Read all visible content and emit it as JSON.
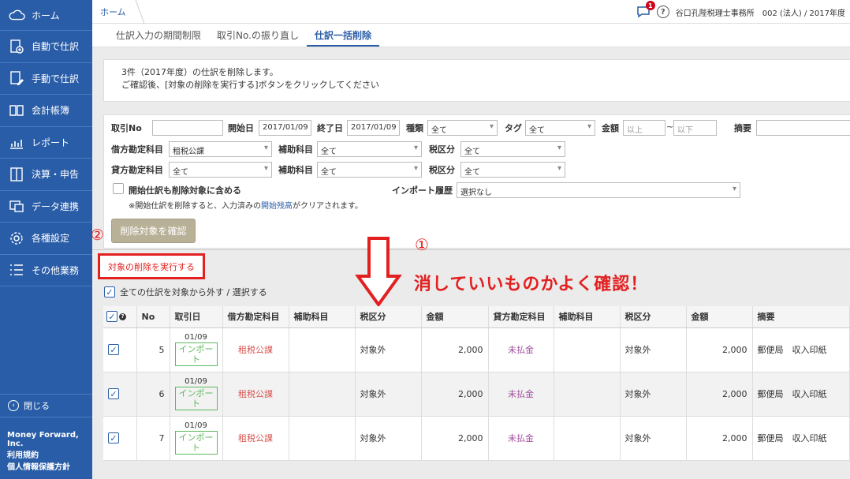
{
  "sidebar": {
    "logo_label": "ホーム",
    "items": [
      {
        "label": "自動で仕訳",
        "icon": "auto-journal-icon"
      },
      {
        "label": "手動で仕訳",
        "icon": "manual-journal-icon"
      },
      {
        "label": "会計帳簿",
        "icon": "ledger-book-icon"
      },
      {
        "label": "レポート",
        "icon": "report-chart-icon"
      },
      {
        "label": "決算・申告",
        "icon": "closing-icon"
      },
      {
        "label": "データ連携",
        "icon": "data-link-icon"
      },
      {
        "label": "各種設定",
        "icon": "gear-icon"
      },
      {
        "label": "その他業務",
        "icon": "list-icon"
      }
    ],
    "close_label": "閉じる",
    "company": "Money Forward, Inc.",
    "terms": "利用規約",
    "privacy": "個人情報保護方針"
  },
  "topbar": {
    "breadcrumb": "ホーム",
    "notification_count": "1",
    "office": "谷口孔陛税理士事務所　002 (法人) / 2017年度"
  },
  "tabs": [
    "仕訳入力の期間制限",
    "取引No.の振り直し",
    "仕訳一括削除"
  ],
  "notice": {
    "line1": "3件（2017年度）の仕訳を削除します。",
    "line2": "ご確認後、[対象の削除を実行する]ボタンをクリックしてください"
  },
  "form": {
    "txn_no_label": "取引No",
    "start_label": "開始日",
    "start_value": "2017/01/09",
    "end_label": "終了日",
    "end_value": "2017/01/09",
    "type_label": "種類",
    "type_value": "全て",
    "tag_label": "タグ",
    "tag_value": "全て",
    "amount_label": "金額",
    "amount_min_ph": "以上",
    "amount_tilde": "~",
    "amount_max_ph": "以下",
    "memo_label": "摘要",
    "debit_label": "借方勘定科目",
    "debit_value": "租税公課",
    "debit_sub_label": "補助科目",
    "debit_sub_value": "全て",
    "debit_tax_label": "税区分",
    "debit_tax_value": "全て",
    "credit_label": "貸方勘定科目",
    "credit_value": "全て",
    "credit_sub_label": "補助科目",
    "credit_sub_value": "全て",
    "credit_tax_label": "税区分",
    "credit_tax_value": "全て",
    "opening_checkbox": "開始仕訳も削除対象に含める",
    "import_label": "インポート履歴",
    "import_value": "選択なし",
    "note": "※開始仕訳を削除すると、入力済みの",
    "note_link": "開始残高",
    "note_end": "がクリアされます。",
    "confirm_button": "削除対象を確認"
  },
  "annotations": {
    "circle1": "①",
    "circle2": "②",
    "big_text": "消していいものかよく確認！"
  },
  "execute_button": "対象の削除を実行する",
  "select_all_label": "全ての仕訳を対象から外す / 選択する",
  "table": {
    "headers": [
      "No",
      "取引日",
      "借方勘定科目",
      "補助科目",
      "税区分",
      "金額",
      "貸方勘定科目",
      "補助科目",
      "税区分",
      "金額",
      "摘要"
    ],
    "rows": [
      {
        "no": "5",
        "date": "01/09",
        "tag": "インポート",
        "debit": "租税公課",
        "debit_sub": "",
        "debit_tax": "対象外",
        "debit_amount": "2,000",
        "credit": "未払金",
        "credit_sub": "",
        "credit_tax": "対象外",
        "credit_amount": "2,000",
        "memo": "郵便局　収入印紙"
      },
      {
        "no": "6",
        "date": "01/09",
        "tag": "インポート",
        "debit": "租税公課",
        "debit_sub": "",
        "debit_tax": "対象外",
        "debit_amount": "2,000",
        "credit": "未払金",
        "credit_sub": "",
        "credit_tax": "対象外",
        "credit_amount": "2,000",
        "memo": "郵便局　収入印紙"
      },
      {
        "no": "7",
        "date": "01/09",
        "tag": "インポート",
        "debit": "租税公課",
        "debit_sub": "",
        "debit_tax": "対象外",
        "debit_amount": "2,000",
        "credit": "未払金",
        "credit_sub": "",
        "credit_tax": "対象外",
        "credit_amount": "2,000",
        "memo": "郵便局　収入印紙"
      }
    ]
  }
}
